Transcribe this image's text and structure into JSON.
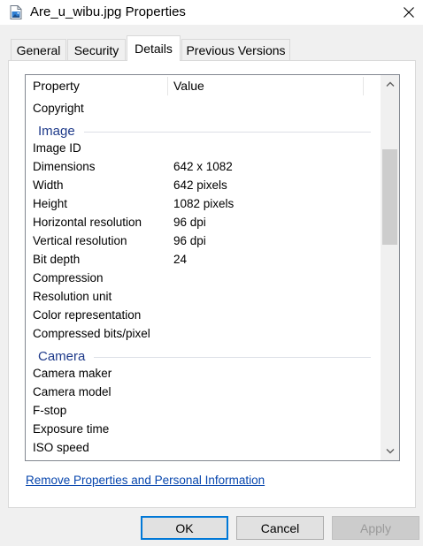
{
  "window": {
    "title": "Are_u_wibu.jpg Properties",
    "close_glyph": "✕"
  },
  "tabs": [
    {
      "label": "General",
      "active": false
    },
    {
      "label": "Security",
      "active": false
    },
    {
      "label": "Details",
      "active": true
    },
    {
      "label": "Previous Versions",
      "active": false
    }
  ],
  "details": {
    "columns": {
      "property": "Property",
      "value": "Value"
    },
    "rows": [
      {
        "kind": "row",
        "property": "Copyright",
        "value": ""
      },
      {
        "kind": "group",
        "label": "Image"
      },
      {
        "kind": "row",
        "property": "Image ID",
        "value": ""
      },
      {
        "kind": "row",
        "property": "Dimensions",
        "value": "642 x 1082"
      },
      {
        "kind": "row",
        "property": "Width",
        "value": "642 pixels"
      },
      {
        "kind": "row",
        "property": "Height",
        "value": "1082 pixels"
      },
      {
        "kind": "row",
        "property": "Horizontal resolution",
        "value": "96 dpi"
      },
      {
        "kind": "row",
        "property": "Vertical resolution",
        "value": "96 dpi"
      },
      {
        "kind": "row",
        "property": "Bit depth",
        "value": "24"
      },
      {
        "kind": "row",
        "property": "Compression",
        "value": ""
      },
      {
        "kind": "row",
        "property": "Resolution unit",
        "value": ""
      },
      {
        "kind": "row",
        "property": "Color representation",
        "value": ""
      },
      {
        "kind": "row",
        "property": "Compressed bits/pixel",
        "value": ""
      },
      {
        "kind": "group",
        "label": "Camera"
      },
      {
        "kind": "row",
        "property": "Camera maker",
        "value": ""
      },
      {
        "kind": "row",
        "property": "Camera model",
        "value": ""
      },
      {
        "kind": "row",
        "property": "F-stop",
        "value": ""
      },
      {
        "kind": "row",
        "property": "Exposure time",
        "value": ""
      },
      {
        "kind": "row",
        "property": "ISO speed",
        "value": ""
      }
    ]
  },
  "links": {
    "remove_properties": "Remove Properties and Personal Information"
  },
  "buttons": {
    "ok": "OK",
    "cancel": "Cancel",
    "apply": "Apply",
    "apply_enabled": false
  },
  "colors": {
    "accent": "#0078d7",
    "group_header": "#1e3a8a",
    "link": "#0645ad"
  },
  "icons": {
    "window": "image-file-icon",
    "close": "close-icon",
    "scroll_up": "chevron-up-icon",
    "scroll_down": "chevron-down-icon"
  }
}
